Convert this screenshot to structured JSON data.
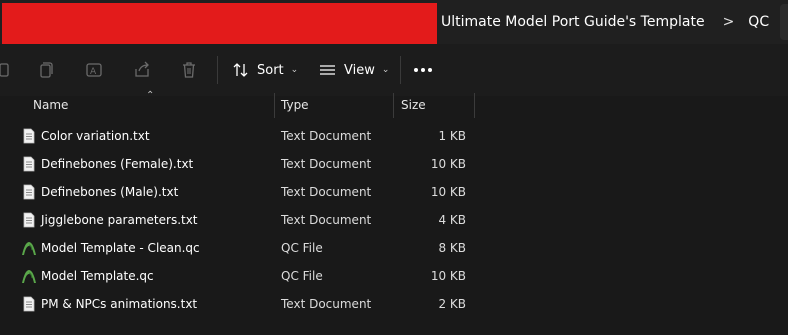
{
  "breadcrumb": {
    "items": [
      "Ultimate Model Port Guide's Template",
      "QC"
    ],
    "separator": ">"
  },
  "toolbar": {
    "sort_label": "Sort",
    "view_label": "View",
    "icons": [
      "copy-icon",
      "rename-icon",
      "share-icon",
      "delete-icon"
    ]
  },
  "columns": {
    "name": "Name",
    "type": "Type",
    "size": "Size"
  },
  "files": [
    {
      "name": "Color variation.txt",
      "type": "Text Document",
      "size": "1 KB",
      "icon": "text-file-icon"
    },
    {
      "name": "Definebones (Female).txt",
      "type": "Text Document",
      "size": "10 KB",
      "icon": "text-file-icon"
    },
    {
      "name": "Definebones (Male).txt",
      "type": "Text Document",
      "size": "10 KB",
      "icon": "text-file-icon"
    },
    {
      "name": "Jigglebone parameters.txt",
      "type": "Text Document",
      "size": "4 KB",
      "icon": "text-file-icon"
    },
    {
      "name": "Model Template - Clean.qc",
      "type": "QC File",
      "size": "8 KB",
      "icon": "qc-file-icon"
    },
    {
      "name": "Model Template.qc",
      "type": "QC File",
      "size": "10 KB",
      "icon": "qc-file-icon"
    },
    {
      "name": "PM & NPCs animations.txt",
      "type": "Text Document",
      "size": "2 KB",
      "icon": "text-file-icon"
    }
  ],
  "colors": {
    "background": "#191919",
    "redaction": "#e31b1b",
    "qc_icon": "#5aa64a"
  }
}
